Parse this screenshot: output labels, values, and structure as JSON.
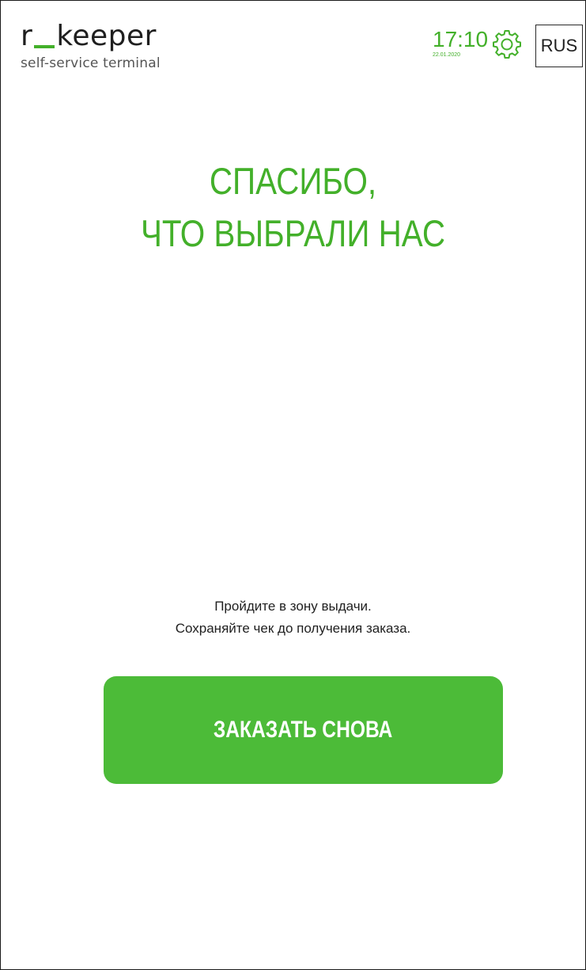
{
  "header": {
    "logo_title_left": "r",
    "logo_title_right": "keeper",
    "logo_subtitle": "self-service terminal",
    "time": "17:10",
    "date": "22.01.2020",
    "settings_icon": "gear-icon",
    "language": "RUS"
  },
  "main": {
    "thanks_line1": "СПАСИБО,",
    "thanks_line2": "ЧТО ВЫБРАЛИ НАС",
    "info_line1": "Пройдите в зону выдачи.",
    "info_line2": "Сохраняйте чек до получения заказа.",
    "order_again_label": "ЗАКАЗАТЬ СНОВА"
  },
  "colors": {
    "accent": "#43b02a",
    "button": "#4cbb38",
    "text": "#1f1f1f",
    "background": "#ffffff"
  }
}
